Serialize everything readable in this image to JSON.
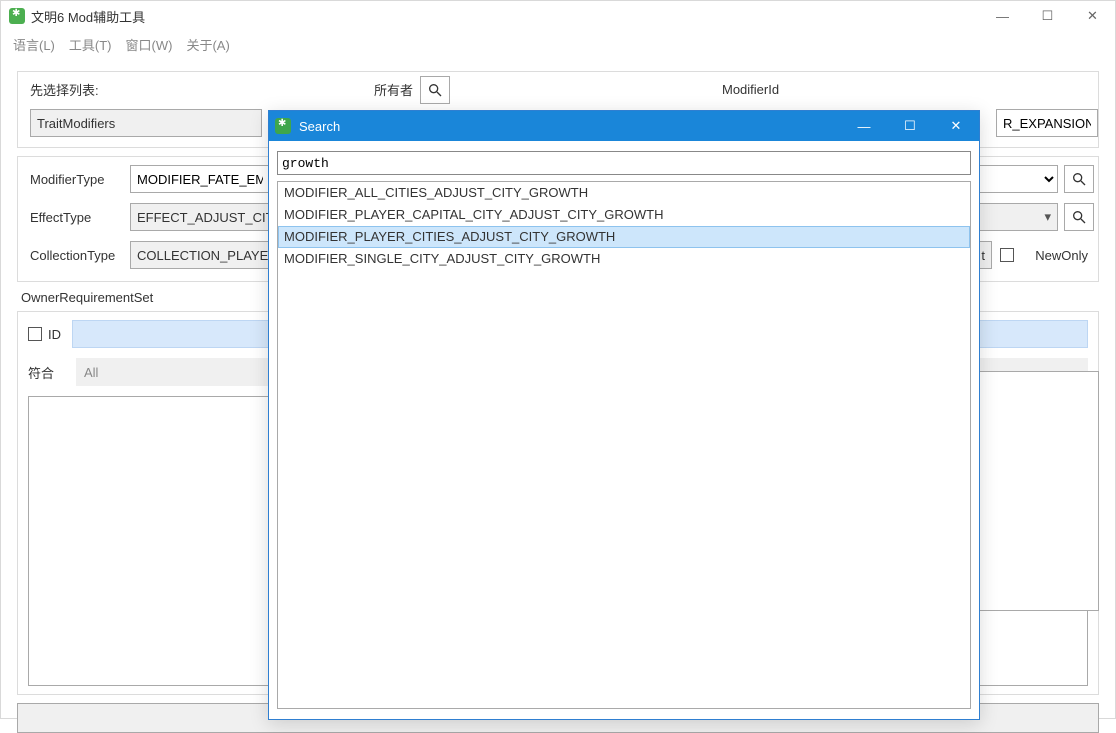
{
  "app": {
    "title": "文明6 Mod辅助工具",
    "menus": [
      "语言(L)",
      "工具(T)",
      "窗口(W)",
      "关于(A)"
    ]
  },
  "group1": {
    "label_select_list": "先选择列表:",
    "select_list_value": "TraitModifiers",
    "label_owner": "所有者",
    "label_modifier_id": "ModifierId",
    "modifier_id_value": "R_EXPANSION"
  },
  "group2": {
    "label_modifier_type": "ModifierType",
    "modifier_type_value": "MODIFIER_FATE_EM",
    "label_effect_type": "EffectType",
    "effect_type_value": "EFFECT_ADJUST_CIT",
    "label_collection_type": "CollectionType",
    "collection_type_value": "COLLECTION_PLAYE",
    "trailing_field_t": "t",
    "label_new_only": "NewOnly"
  },
  "owner_req": {
    "label": "OwnerRequirementSet",
    "id_label": "ID",
    "match_label": "符合",
    "match_value": "All"
  },
  "search": {
    "title": "Search",
    "query": "growth",
    "results": [
      "MODIFIER_ALL_CITIES_ADJUST_CITY_GROWTH",
      "MODIFIER_PLAYER_CAPITAL_CITY_ADJUST_CITY_GROWTH",
      "MODIFIER_PLAYER_CITIES_ADJUST_CITY_GROWTH",
      "MODIFIER_SINGLE_CITY_ADJUST_CITY_GROWTH"
    ],
    "selected_index": 2
  },
  "win_controls": {
    "min": "—",
    "max": "☐",
    "close": "✕"
  }
}
